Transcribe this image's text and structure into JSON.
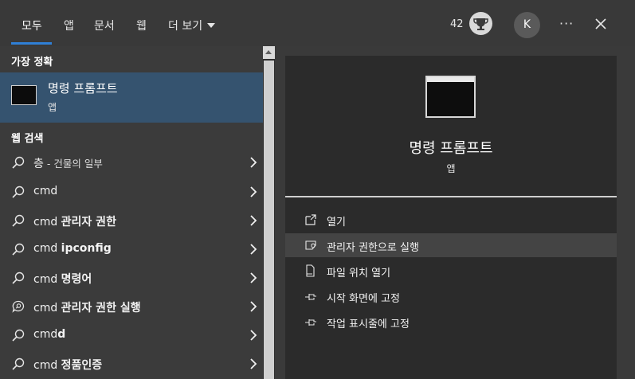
{
  "tabs": [
    {
      "label": "모두"
    },
    {
      "label": "앱"
    },
    {
      "label": "문서"
    },
    {
      "label": "웹"
    },
    {
      "label": "더 보기"
    }
  ],
  "header": {
    "rewards_count": "42",
    "avatar_initial": "K",
    "more_label": "···"
  },
  "best_match": {
    "section_label": "가장 정확",
    "title": "명령 프롬프트",
    "subtitle": "앱"
  },
  "web_search": {
    "section_label": "웹 검색",
    "items": [
      {
        "prefix": "층",
        "bold": "",
        "note": "- 건물의 일부",
        "icon": "search-icon"
      },
      {
        "prefix": "cmd",
        "bold": "",
        "note": "",
        "icon": "search-icon"
      },
      {
        "prefix": "cmd ",
        "bold": "관리자 권한",
        "note": "",
        "icon": "search-icon"
      },
      {
        "prefix": "cmd ",
        "bold": "ipconfig",
        "note": "",
        "icon": "search-icon"
      },
      {
        "prefix": "cmd ",
        "bold": "명령어",
        "note": "",
        "icon": "search-icon"
      },
      {
        "prefix": "cmd ",
        "bold": "관리자 권한 실행",
        "note": "",
        "icon": "chat-search-icon"
      },
      {
        "prefix": "cmd",
        "bold": "d",
        "note": "",
        "icon": "search-icon"
      },
      {
        "prefix": "cmd ",
        "bold": "정품인증",
        "note": "",
        "icon": "search-icon"
      }
    ]
  },
  "preview": {
    "title": "명령 프롬프트",
    "subtitle": "앱",
    "actions": [
      {
        "label": "열기",
        "icon": "open-icon"
      },
      {
        "label": "관리자 권한으로 실행",
        "icon": "shield-icon"
      },
      {
        "label": "파일 위치 열기",
        "icon": "file-location-icon"
      },
      {
        "label": "시작 화면에 고정",
        "icon": "pin-icon"
      },
      {
        "label": "작업 표시줄에 고정",
        "icon": "pin-icon"
      }
    ]
  },
  "colors": {
    "accent": "#2f7fd6",
    "selected_row": "#35536f",
    "panel_bg": "#2b2b2b"
  }
}
